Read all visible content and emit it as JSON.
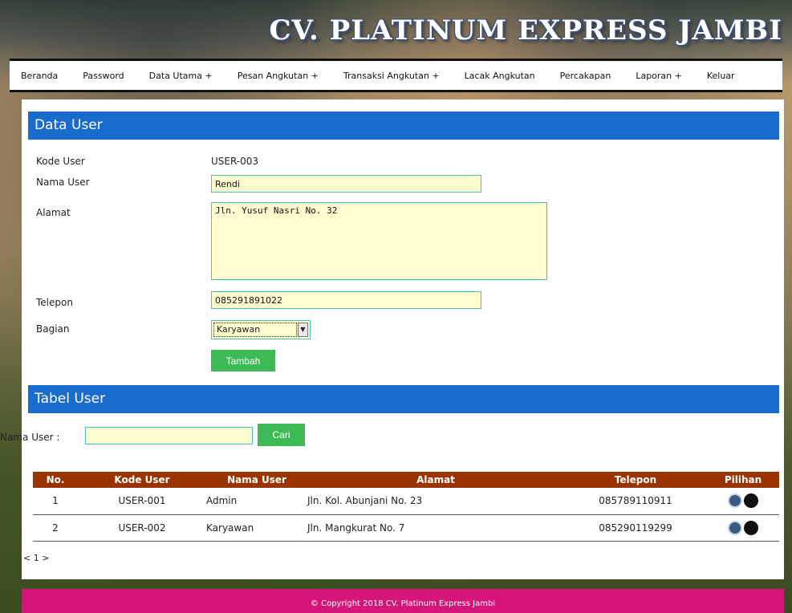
{
  "header": {
    "brand": "CV. PLATINUM EXPRESS JAMBI"
  },
  "nav": {
    "items": [
      {
        "label": "Beranda",
        "name": "nav-beranda"
      },
      {
        "label": "Password",
        "name": "nav-password"
      },
      {
        "label": "Data Utama +",
        "name": "nav-data-utama"
      },
      {
        "label": "Pesan Angkutan +",
        "name": "nav-pesan-angkutan"
      },
      {
        "label": "Transaksi Angkutan +",
        "name": "nav-transaksi-angkutan"
      },
      {
        "label": "Lacak Angkutan",
        "name": "nav-lacak-angkutan"
      },
      {
        "label": "Percakapan",
        "name": "nav-percakapan"
      },
      {
        "label": "Laporan +",
        "name": "nav-laporan"
      },
      {
        "label": "Keluar",
        "name": "nav-keluar"
      }
    ]
  },
  "form": {
    "title": "Data User",
    "kode_label": "Kode User",
    "kode_value": "USER-003",
    "nama_label": "Nama User",
    "nama_value": "Rendi",
    "alamat_label": "Alamat",
    "alamat_value": "Jln. Yusuf Nasri No. 32",
    "telepon_label": "Telepon",
    "telepon_value": "085291891022",
    "bagian_label": "Bagian",
    "bagian_value": "Karyawan",
    "submit_label": "Tambah"
  },
  "table_section": {
    "title": "Tabel User",
    "search_label": "Nama User :",
    "search_value": "",
    "search_button": "Cari",
    "columns": [
      "No.",
      "Kode User",
      "Nama User",
      "Alamat",
      "Telepon",
      "Pilihan"
    ],
    "rows": [
      {
        "no": "1",
        "kode": "USER-001",
        "nama": "Admin",
        "alamat": "Jln. Kol. Abunjani No. 23",
        "telepon": "085789110911"
      },
      {
        "no": "2",
        "kode": "USER-002",
        "nama": "Karyawan",
        "alamat": "Jln. Mangkurat No. 7",
        "telepon": "085290119299"
      }
    ],
    "pager": "< 1 >"
  },
  "footer": {
    "text": "© Copyright 2018 CV. Platinum Express Jambi"
  },
  "icons": {
    "edit": "edit-icon",
    "delete": "delete-icon",
    "dropdown": "chevron-down-icon"
  },
  "colors": {
    "section_header": "#1a6ccc",
    "table_header": "#993300",
    "button": "#3dba55",
    "footer": "#d6157a",
    "input_bg": "#fffdd0"
  }
}
